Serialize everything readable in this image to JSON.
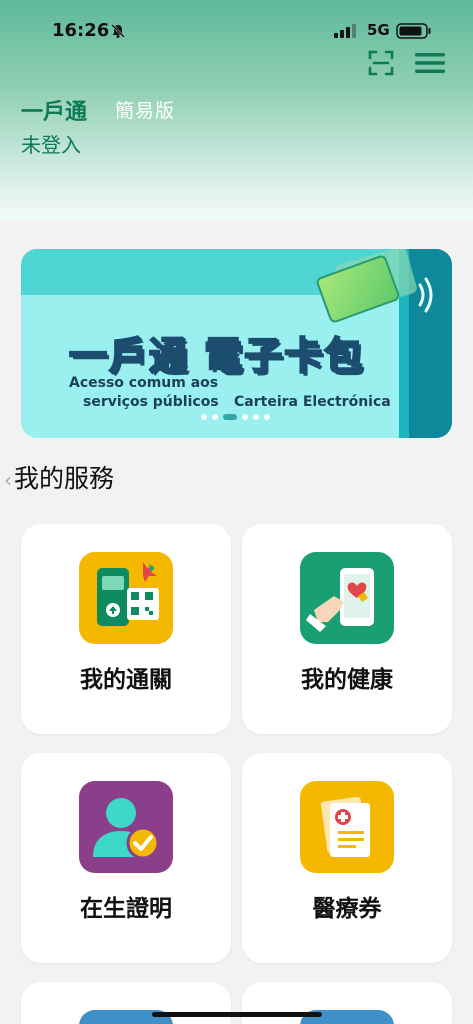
{
  "status_bar": {
    "time": "16:26",
    "network": "5G"
  },
  "header": {
    "brand": "一戶通",
    "brand_sub": "簡易版",
    "login_status": "未登入"
  },
  "banner": {
    "title": "一戶通 電子卡包",
    "text_pt_1": "Acesso comum aos",
    "text_pt_2": "serviços públicos",
    "text_pt_3": "Carteira Electrónica",
    "active_slide": 3,
    "slide_count": 6
  },
  "services": {
    "section_title": "我的服務",
    "items": [
      {
        "label": "我的通關",
        "icon": "customs-clearance-icon",
        "bg": "#f5b800"
      },
      {
        "label": "我的健康",
        "icon": "health-icon",
        "bg": "#1a9e74"
      },
      {
        "label": "在生證明",
        "icon": "proof-of-life-icon",
        "bg": "#8b3f8a"
      },
      {
        "label": "醫療券",
        "icon": "medical-voucher-icon",
        "bg": "#f5b800"
      }
    ]
  },
  "colors": {
    "brand_green": "#0d7a55"
  }
}
